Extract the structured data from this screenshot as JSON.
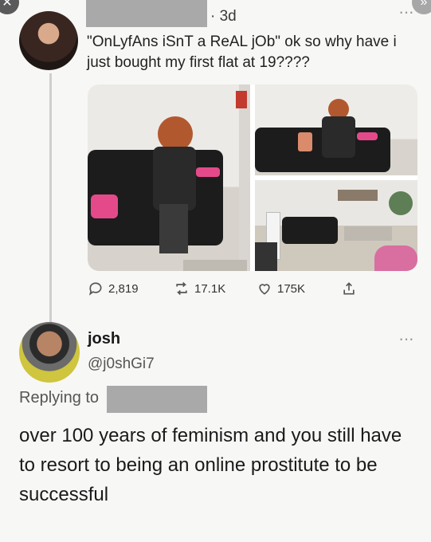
{
  "tweet": {
    "timestamp": "· 3d",
    "text": "\"OnLyfAns iSnT a ReAL jOb\" ok so why have i just bought my first flat at 19????",
    "stats": {
      "replies": "2,819",
      "retweets": "17.1K",
      "likes": "175K"
    }
  },
  "reply": {
    "name": "josh",
    "handle": "@j0shGi7",
    "replying_label": "Replying to",
    "text": "over 100 years of feminism and you still have to resort to being an online prostitute to be successful"
  },
  "icons": {
    "reply": "comment-icon",
    "retweet": "retweet-icon",
    "like": "heart-icon",
    "share": "share-icon",
    "more": "more-icon"
  },
  "colors": {
    "background": "#f7f7f5",
    "text": "#1a1a1a",
    "muted": "#555555",
    "redaction": "#a9a9a9"
  }
}
